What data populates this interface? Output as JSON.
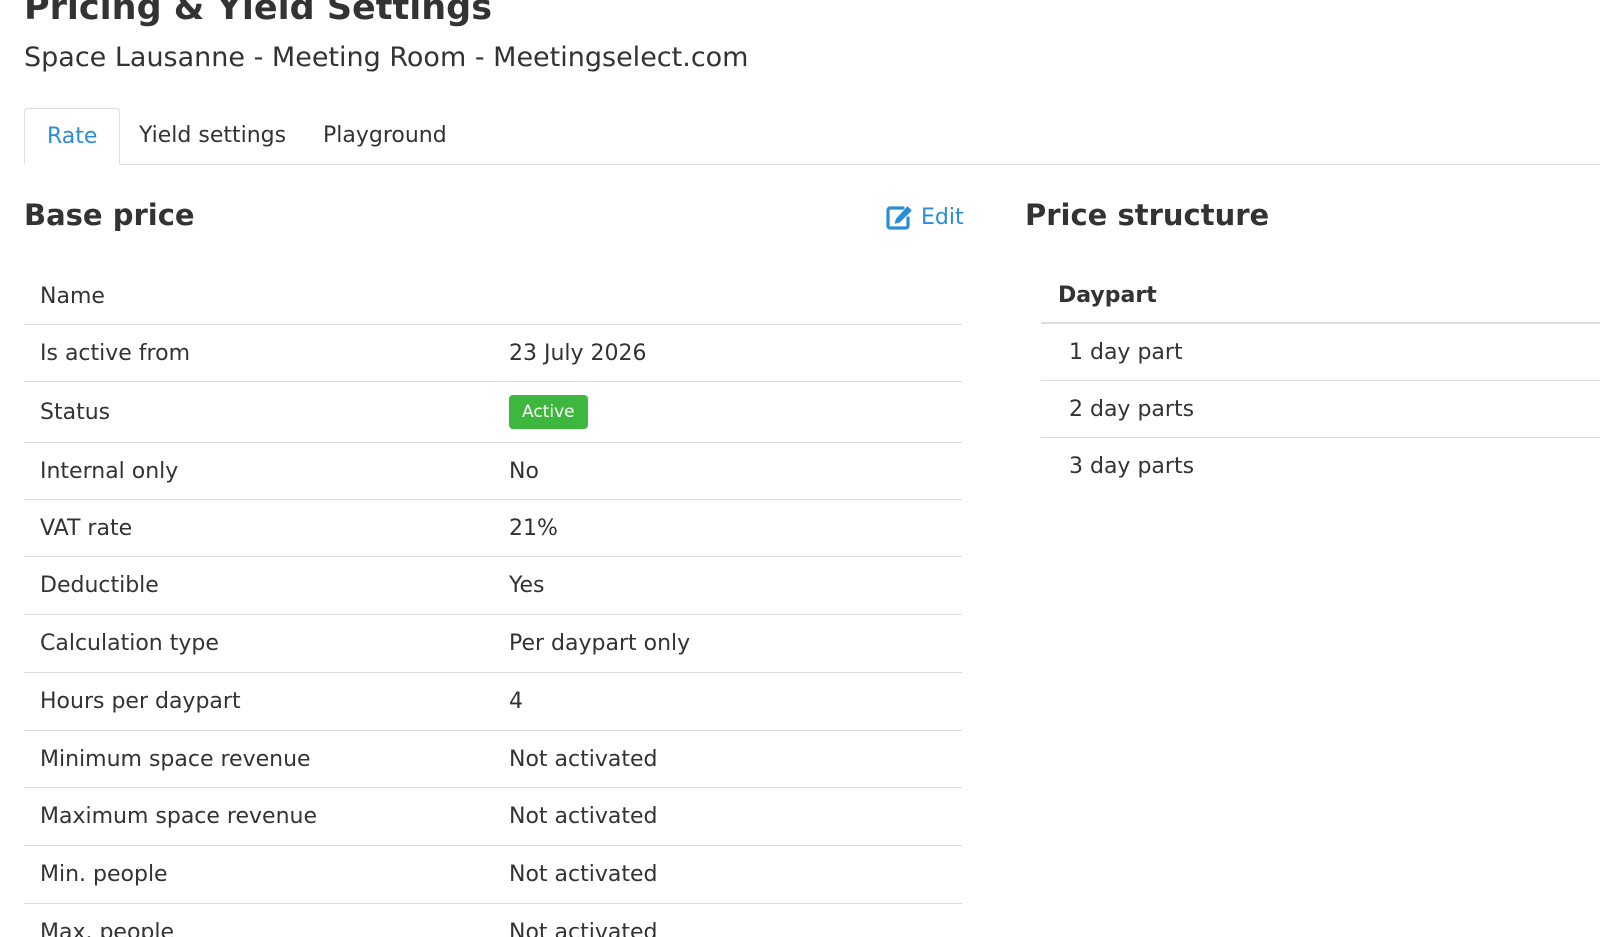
{
  "page": {
    "title": "Pricing & Yield Settings",
    "subtitle": "Space Lausanne - Meeting Room - Meetingselect.com"
  },
  "tabs": [
    {
      "label": "Rate",
      "active": true
    },
    {
      "label": "Yield settings",
      "active": false
    },
    {
      "label": "Playground",
      "active": false
    }
  ],
  "base_price": {
    "title": "Base price",
    "edit_label": "Edit",
    "edit_icon": "edit-icon",
    "rows": [
      {
        "label": "Name",
        "value": ""
      },
      {
        "label": "Is active from",
        "value": "23 July 2026"
      },
      {
        "label": "Status",
        "value": "Active"
      },
      {
        "label": "Internal only",
        "value": "No"
      },
      {
        "label": "VAT rate",
        "value": "21%"
      },
      {
        "label": "Deductible",
        "value": "Yes"
      },
      {
        "label": "Calculation type",
        "value": "Per daypart only"
      },
      {
        "label": "Hours per daypart",
        "value": "4"
      },
      {
        "label": "Minimum space revenue",
        "value": "Not activated"
      },
      {
        "label": "Maximum space revenue",
        "value": "Not activated"
      },
      {
        "label": "Min. people",
        "value": "Not activated"
      },
      {
        "label": "Max. people",
        "value": "Not activated"
      }
    ]
  },
  "price_structure": {
    "title": "Price structure",
    "column_header": "Daypart",
    "rows": [
      "1 day part",
      "2 day parts",
      "3 day parts"
    ]
  },
  "colors": {
    "accent": "#2a8ed6",
    "status_active": "#3db73d",
    "text": "#333333",
    "border": "#dddddd"
  }
}
